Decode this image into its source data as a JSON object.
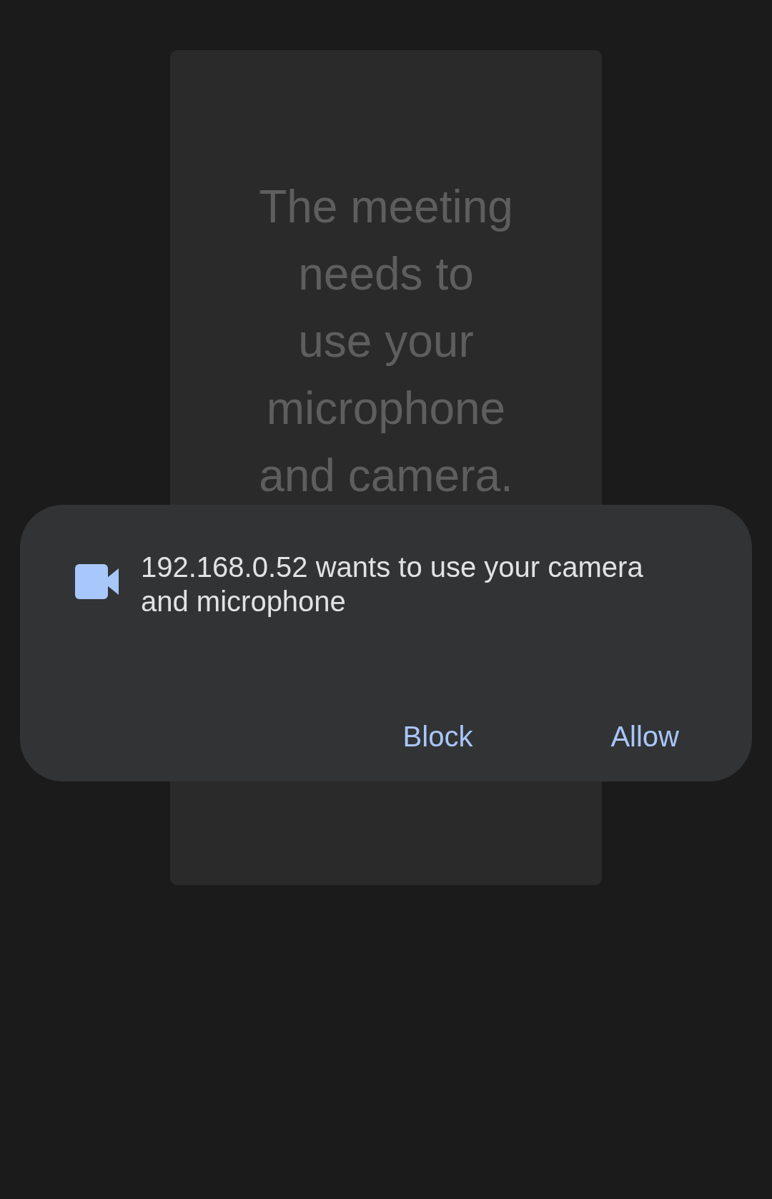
{
  "meeting_card": {
    "message": "The meeting needs to use your microphone and camera."
  },
  "permission_dialog": {
    "message": "192.168.0.52 wants to use your camera and microphone",
    "buttons": [
      {
        "label": "Block"
      },
      {
        "label": "Allow"
      }
    ]
  }
}
